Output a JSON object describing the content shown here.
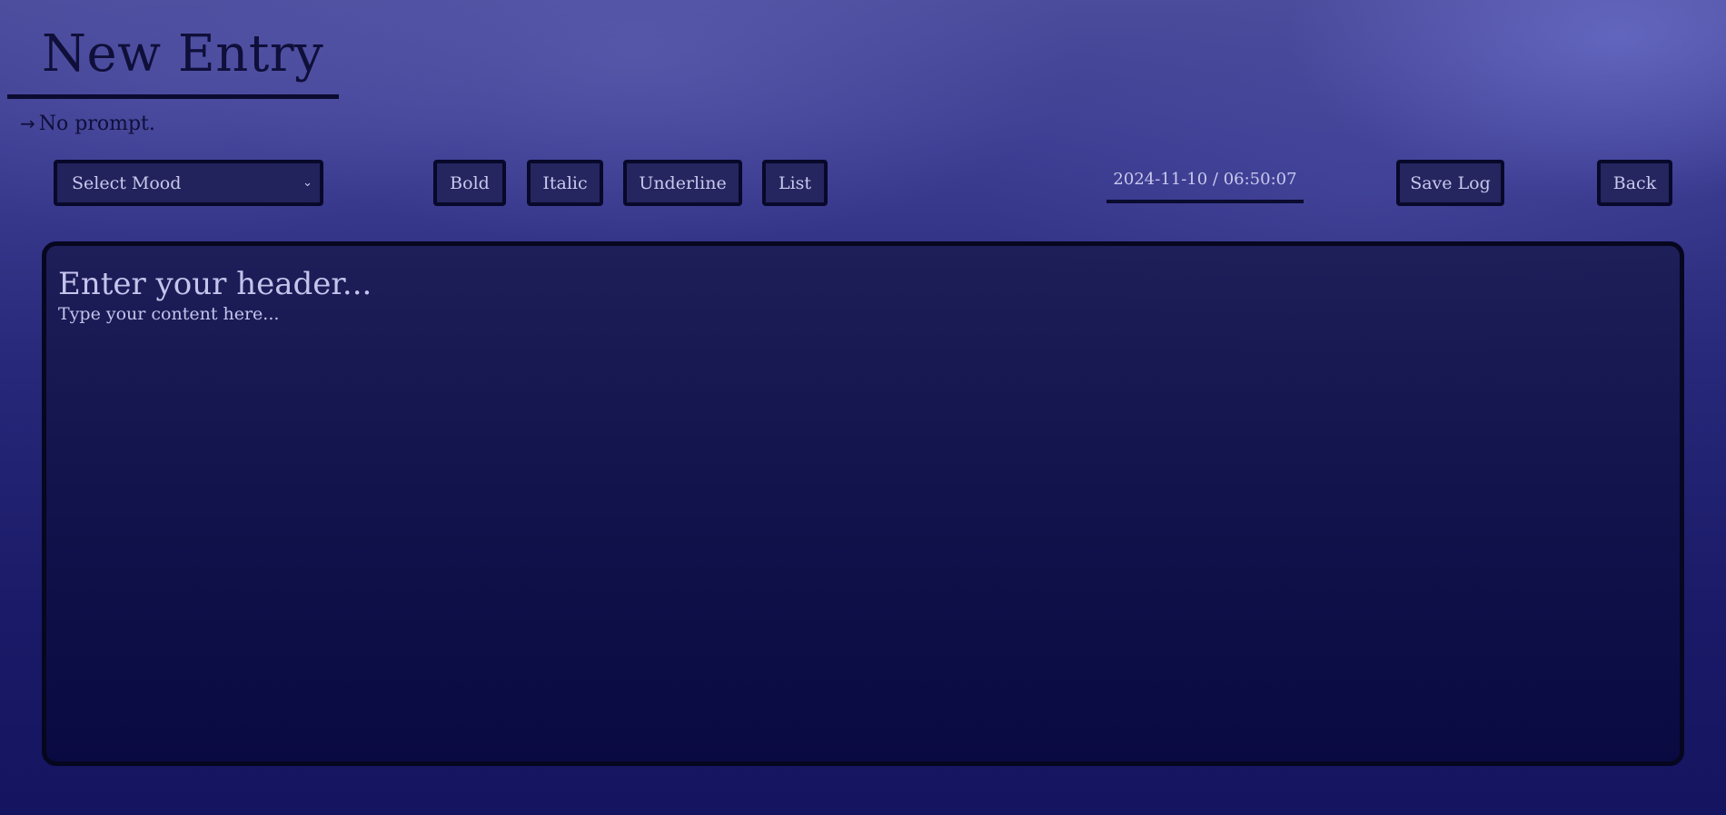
{
  "page": {
    "title": "New Entry",
    "prompt_arrow": "→",
    "prompt_text": "No prompt."
  },
  "toolbar": {
    "mood_select": {
      "selected": "Select Mood",
      "chevron_icon": "chevron-down-icon"
    },
    "bold_label": "Bold",
    "italic_label": "Italic",
    "underline_label": "Underline",
    "list_label": "List",
    "timestamp": "2024-11-10 / 06:50:07",
    "save_label": "Save Log",
    "back_label": "Back"
  },
  "editor": {
    "header_placeholder": "Enter your header...",
    "content_placeholder": "Type your content here..."
  },
  "colors": {
    "background_top": "#4c4c9c",
    "background_bottom": "#141460",
    "button_fill": "#25255f",
    "border": "#08082a",
    "text_light": "#c9c9ee",
    "text_dark": "#0f0f3a"
  }
}
